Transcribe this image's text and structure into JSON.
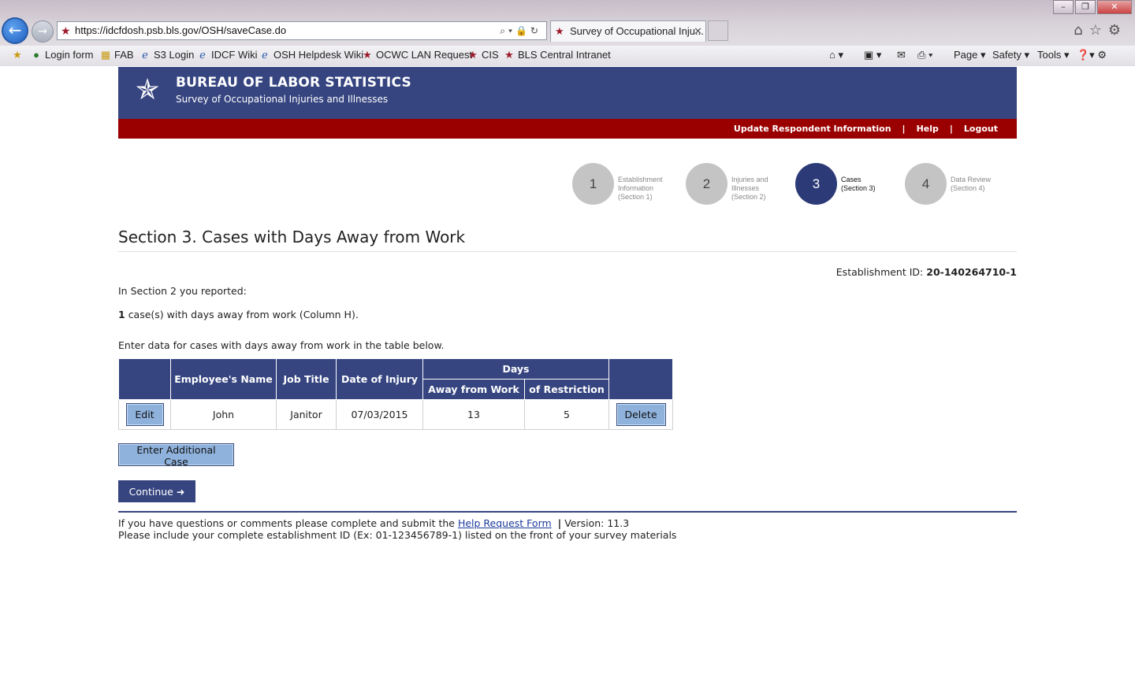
{
  "browser": {
    "url": "https://idcfdosh.psb.bls.gov/OSH/saveCase.do",
    "tab_title": "Survey of Occupational Inju...",
    "favorites": [
      {
        "label": "Login form",
        "icon": "globe-icon"
      },
      {
        "label": "FAB",
        "icon": "folder-icon"
      },
      {
        "label": "S3 Login",
        "icon": "ie-page-icon"
      },
      {
        "label": "IDCF Wiki",
        "icon": "ie-page-icon"
      },
      {
        "label": "OSH Helpdesk Wiki",
        "icon": "ie-page-icon"
      },
      {
        "label": "OCWC LAN Request",
        "icon": "bls-star-icon"
      },
      {
        "label": "CIS",
        "icon": "bls-star-icon"
      },
      {
        "label": "BLS Central Intranet",
        "icon": "bls-star-icon"
      }
    ],
    "commands": {
      "page": "Page",
      "safety": "Safety",
      "tools": "Tools"
    }
  },
  "banner": {
    "title": "BUREAU OF LABOR STATISTICS",
    "subtitle": "Survey of Occupational Injuries and Illnesses"
  },
  "topnav": {
    "update": "Update Respondent Information",
    "help": "Help",
    "logout": "Logout"
  },
  "steps": [
    {
      "num": "1",
      "line1": "Establishment",
      "line2": "Information",
      "line3": "(Section 1)",
      "active": false
    },
    {
      "num": "2",
      "line1": "Injuries and",
      "line2": "Illnesses",
      "line3": "(Section 2)",
      "active": false
    },
    {
      "num": "3",
      "line1": "Cases",
      "line2": "(Section 3)",
      "line3": "",
      "active": true
    },
    {
      "num": "4",
      "line1": "Data Review",
      "line2": "(Section 4)",
      "line3": "",
      "active": false
    }
  ],
  "section_title": "Section 3. Cases with Days Away from Work",
  "establishment": {
    "label": "Establishment ID:",
    "value": "20-140264710-1"
  },
  "intro": "In Section 2 you reported:",
  "count": {
    "value": "1",
    "text": "case(s) with days away from work (Column H)."
  },
  "instruction": "Enter data for cases with days away from work in the table below.",
  "table": {
    "headers": {
      "name": "Employee's Name",
      "job": "Job Title",
      "date": "Date of Injury",
      "days": "Days",
      "away": "Away from Work",
      "restriction": "of Restriction"
    },
    "rows": [
      {
        "edit": "Edit",
        "name": "John",
        "job": "Janitor",
        "date": "07/03/2015",
        "away": "13",
        "restriction": "5",
        "delete": "Delete"
      }
    ]
  },
  "buttons": {
    "additional": "Enter Additional Case",
    "continue": "Continue"
  },
  "footer": {
    "pre": "If you have questions or comments please complete and submit the",
    "link": "Help Request Form",
    "version": "Version: 11.3",
    "line2": "Please include your complete establishment ID (Ex: 01-123456789-1) listed on the front of your survey materials"
  }
}
